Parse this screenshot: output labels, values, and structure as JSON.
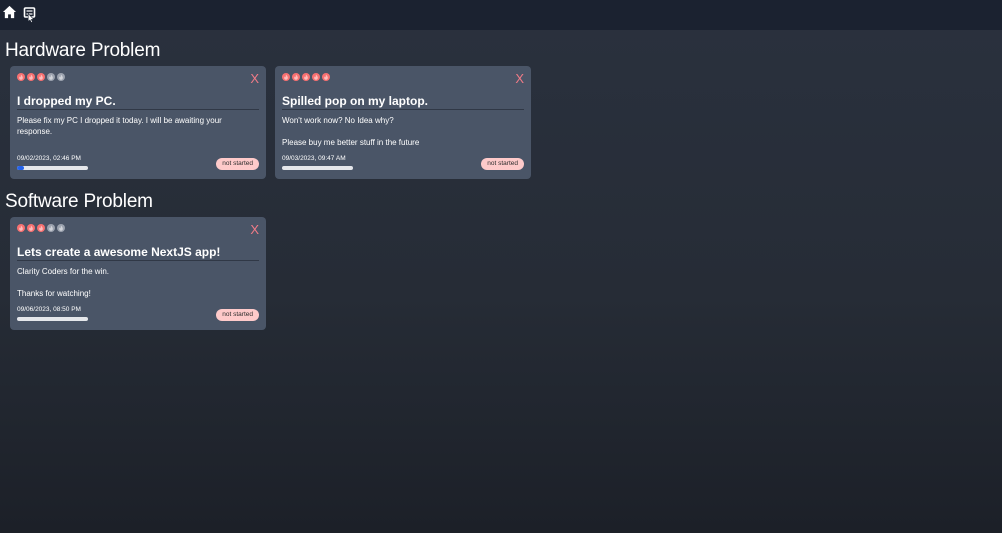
{
  "colors": {
    "background": "#262c36",
    "navbar": "#1b2230",
    "card": "#4a5567",
    "accent_red": "#f07b87",
    "badge_bg": "#fecaca",
    "progress_fill": "#2563eb",
    "flame_active": "#f87171",
    "flame_inactive": "#9ca3af"
  },
  "nav": {
    "items": [
      {
        "icon": "home-icon"
      },
      {
        "icon": "ticket-icon"
      }
    ]
  },
  "delete_label": "X",
  "categories": [
    {
      "name": "Hardware Problem",
      "tickets": [
        {
          "title": "I dropped my PC.",
          "description": "Please fix my PC I dropped it today. I will be awaiting your response.",
          "priority": 3,
          "priority_max": 5,
          "timestamp": "09/02/2023, 02:46 PM",
          "progress": 0.1,
          "status": "not started"
        },
        {
          "title": "Spilled pop on my laptop.",
          "description": "Won't work now? No Idea why?\n\nPlease buy me better stuff in the future",
          "priority": 5,
          "priority_max": 5,
          "timestamp": "09/03/2023, 09:47 AM",
          "progress": 0,
          "status": "not started"
        }
      ]
    },
    {
      "name": "Software Problem",
      "tickets": [
        {
          "title": "Lets create a awesome NextJS app!",
          "description": "Clarity Coders for the win.\n\nThanks for watching!",
          "priority": 3,
          "priority_max": 5,
          "timestamp": "09/06/2023, 08:50 PM",
          "progress": 0,
          "status": "not started"
        }
      ]
    }
  ]
}
